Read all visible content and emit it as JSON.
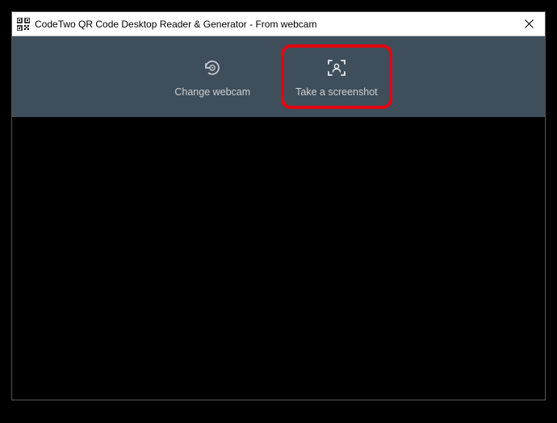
{
  "window": {
    "title": "CodeTwo QR Code Desktop Reader & Generator - From webcam"
  },
  "toolbar": {
    "change_webcam_label": "Change webcam",
    "take_screenshot_label": "Take a screenshot"
  }
}
